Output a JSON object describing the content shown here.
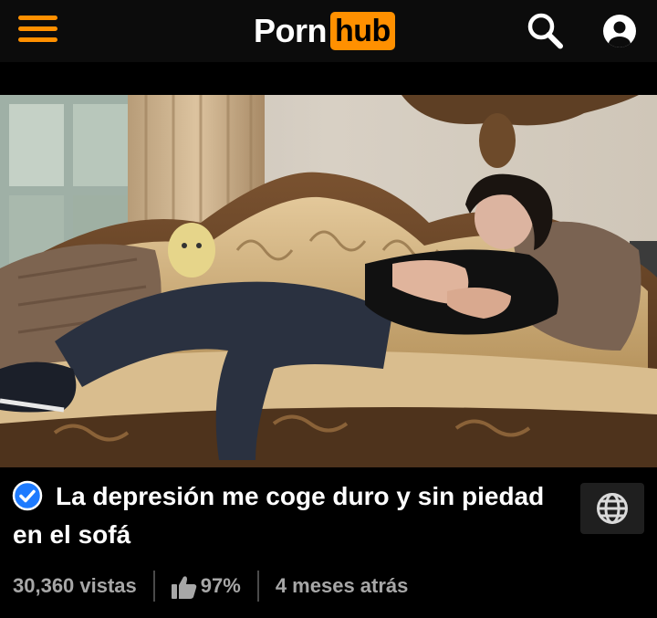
{
  "header": {
    "menu_icon": "hamburger-menu-icon",
    "logo": {
      "part1": "Porn",
      "part2": "hub"
    },
    "search_icon": "search-icon",
    "account_icon": "user-account-icon",
    "accent_color": "#ff9000"
  },
  "video": {
    "thumbnail": "man lying on ornate sofa",
    "verified_icon": "verified-check-icon",
    "title": "La depresión me coge duro y sin piedad en el sofá",
    "language_icon": "globe-icon",
    "views": "30,360 vistas",
    "rating_icon": "thumbs-up-icon",
    "rating": "97%",
    "age": "4 meses atrás"
  }
}
